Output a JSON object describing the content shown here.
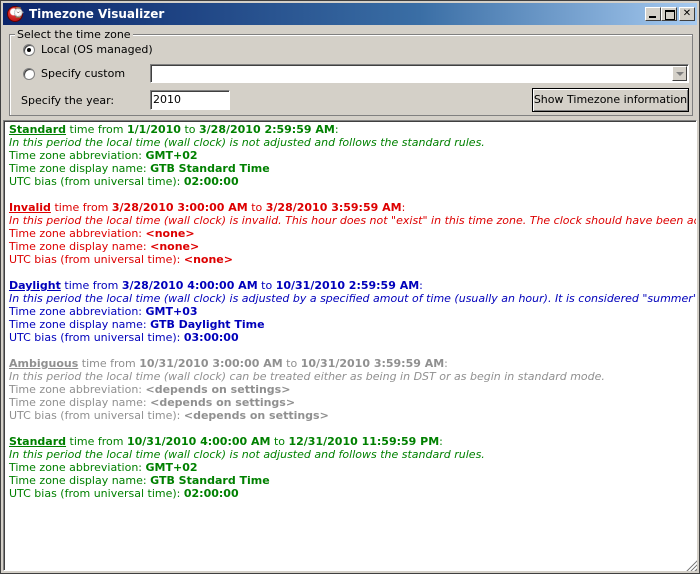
{
  "window": {
    "title": "Timezone Visualizer",
    "icon": "app-clock-icon"
  },
  "controls": {
    "group_label": "Select the time zone",
    "local_label": "Local (OS managed)",
    "local_selected": true,
    "custom_label": "Specify custom",
    "custom_value": "",
    "year_label": "Specify the year:",
    "year_value": "2010",
    "show_button_label": "Show Timezone information"
  },
  "labels": {
    "time_from": "time from",
    "to": "to",
    "abbreviation": "Time zone abbreviation:",
    "display_name": "Time zone display name:",
    "utc_bias": "UTC bias (from universal time):"
  },
  "periods": [
    {
      "kind": "Standard",
      "color": "#008000",
      "from": "1/1/2010",
      "to": "3/28/2010 2:59:59 AM",
      "description": "In this period the local time (wall clock) is not adjusted and follows the standard rules.",
      "abbreviation": "GMT+02",
      "display_name": "GTB Standard Time",
      "utc_bias": "02:00:00"
    },
    {
      "kind": "Invalid",
      "color": "#dd0000",
      "from": "3/28/2010 3:00:00 AM",
      "to": "3/28/2010 3:59:59 AM",
      "description": "In this period the local time (wall clock) is invalid. This hour does not \"exist\" in this time zone. The clock should have been adjusted accordinly.",
      "abbreviation": "<none>",
      "display_name": "<none>",
      "utc_bias": "<none>"
    },
    {
      "kind": "Daylight",
      "color": "#0000bb",
      "from": "3/28/2010 4:00:00 AM",
      "to": "10/31/2010 2:59:59 AM",
      "description": "In this period the local time (wall clock) is adjusted by a specified amout of time (usually an hour). It is considered \"summer\" time.",
      "abbreviation": "GMT+03",
      "display_name": "GTB Daylight Time",
      "utc_bias": "03:00:00"
    },
    {
      "kind": "Ambiguous",
      "color": "#909090",
      "from": "10/31/2010 3:00:00 AM",
      "to": "10/31/2010 3:59:59 AM",
      "description": "In this period the local time (wall clock) can be treated either as being in DST or as begin in standard mode.",
      "abbreviation": "<depends on settings>",
      "display_name": "<depends on settings>",
      "utc_bias": "<depends on settings>"
    },
    {
      "kind": "Standard",
      "color": "#008000",
      "from": "10/31/2010 4:00:00 AM",
      "to": "12/31/2010 11:59:59 PM",
      "description": "In this period the local time (wall clock) is not adjusted and follows the standard rules.",
      "abbreviation": "GMT+02",
      "display_name": "GTB Standard Time",
      "utc_bias": "02:00:00"
    }
  ]
}
